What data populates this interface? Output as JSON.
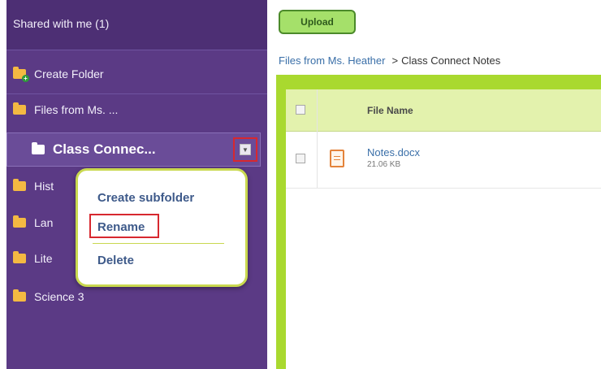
{
  "sidebar": {
    "header": "Shared with me (1)",
    "create_folder": "Create Folder",
    "files_from": "Files from Ms. ...",
    "selected_folder": "Class Connec...",
    "folders": [
      "Hist",
      "Lan",
      "Lite"
    ],
    "science": "Science 3"
  },
  "context_menu": {
    "create_subfolder": "Create subfolder",
    "rename": "Rename",
    "delete": "Delete"
  },
  "toolbar": {
    "upload_label": "Upload"
  },
  "breadcrumb": {
    "parent": "Files from Ms. Heather",
    "separator": ">",
    "current": "Class Connect Notes"
  },
  "file_table": {
    "column_header": "File Name",
    "rows": [
      {
        "name": "Notes.docx",
        "size": "21.06 KB"
      }
    ]
  },
  "colors": {
    "sidebar_bg": "#5b3a85",
    "accent_green": "#a9d92f",
    "highlight_red": "#d7282f"
  }
}
